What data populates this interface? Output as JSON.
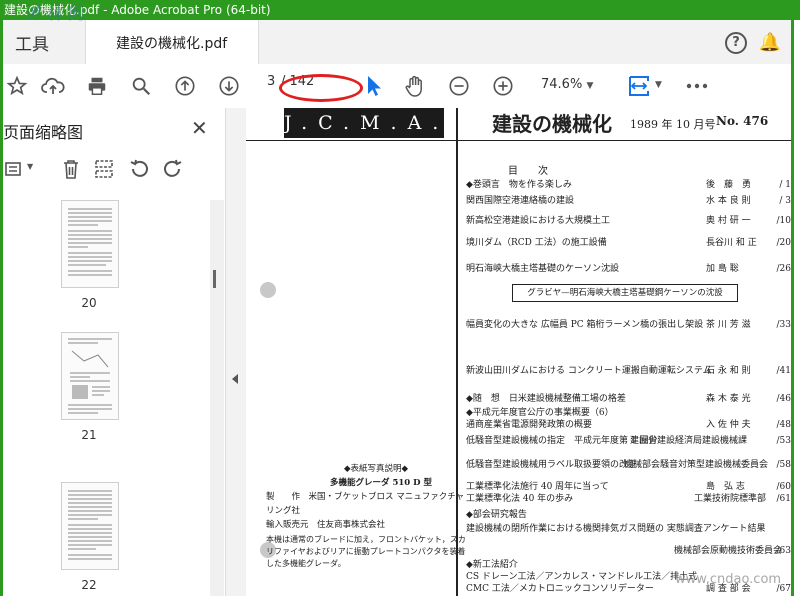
{
  "window": {
    "title": "建設の機械化.pdf - Adobe Acrobat Pro (64-bit)"
  },
  "tabs": {
    "tools_label": "工具",
    "document_label": "建設の機械化.pdf"
  },
  "toolbar": {
    "current_page": "3",
    "total_pages": "/ 142",
    "zoom": "74.6%",
    "icons": [
      "star-icon",
      "cloud-upload-icon",
      "print-icon",
      "search-icon",
      "page-up-icon",
      "page-down-icon",
      "pointer-icon",
      "hand-icon",
      "zoom-out-icon",
      "zoom-in-icon",
      "fit-page-icon",
      "more-icon"
    ]
  },
  "sidebar": {
    "title": "页面缩略图",
    "thumbnails": [
      {
        "label": "20"
      },
      {
        "label": "21"
      },
      {
        "label": "22"
      }
    ]
  },
  "document": {
    "header_badge": "J.C.M.A.",
    "magazine_title": "建設の機械化",
    "issue_date": "1989 年 10 月号",
    "issue_no": "No. 476",
    "toc_title": "目　　次",
    "toc": [
      {
        "title": "◆巻頭言　物を作る楽しみ",
        "author": "後　藤　勇",
        "page": "/ 1"
      },
      {
        "title": "関西国際空港連絡橋の建設",
        "author": "水 本 良 則",
        "page": "/ 3"
      },
      {
        "title": "新高松空港建設における大規模土工",
        "author": "奥 村 研 一",
        "page": "/10"
      },
      {
        "title": "境川ダム（RCD 工法）の施工設備",
        "author": "長谷川 和 正",
        "page": "/20"
      },
      {
        "title": "明石海峡大橋主塔基礎のケーソン沈設",
        "author": "加 島 聡",
        "page": "/26"
      },
      {
        "title": "幅員変化の大きな 広幅員 PC 箱桁ラーメン橋の張出し架設",
        "author": "茶 川 芳 滋",
        "page": "/33"
      },
      {
        "title": "新波山田川ダムにおける コンクリート運搬自動運転システム",
        "author": "石 永 和 則",
        "page": "/41"
      },
      {
        "title": "◆随　想　日米建設機械整備工場の格差",
        "author": "森 木 泰 光",
        "page": "/46"
      },
      {
        "title": "◆平成元年度官公庁の事業概要（6）",
        "author": "",
        "page": ""
      },
      {
        "title": "通商産業省電源開発政策の概要",
        "author": "入 佐 仲 夫",
        "page": "/48"
      },
      {
        "title": "低騒音型建設機械の指定　平成元年度第 1 回分",
        "author": "建設省建設経済局建設機械課",
        "page": "/53"
      },
      {
        "title": "低騒音型建設機械用ラベル取扱要領の改正",
        "author": "機械部会騒音対策型建設機械委員会",
        "page": "/58"
      },
      {
        "title": "工業標準化法施行 40 周年に当って",
        "author": "島　弘 志",
        "page": "/60"
      },
      {
        "title": "工業標準化法 40 年の歩み",
        "author": "工業技術院標準部",
        "page": "/61"
      },
      {
        "title": "◆部会研究報告",
        "author": "",
        "page": ""
      },
      {
        "title": "建設機械の閉所作業における機関排気ガス問題の 実態調査アンケート結果",
        "author": "機械部会原動機技術委員会",
        "page": "/63"
      },
      {
        "title": "◆新工法紹介",
        "author": "",
        "page": ""
      },
      {
        "title": "CS ドレーン工法／アンカレス・マンドレル工法／排土式",
        "author": "",
        "page": ""
      },
      {
        "title": "CMC 工法／メカトロニックコンソリデーター",
        "author": "調 査 部 会",
        "page": "/67"
      }
    ],
    "gravure": "グラビヤ—明石海峡大橋主塔基礎鋼ケーソンの沈設",
    "cover": {
      "heading": "◆表紙写真説明◆",
      "model": "多機能グレーダ 510 D 型",
      "maker_label": "製　　作",
      "maker": "米国・ブケットブロス マニュファクチャリング社",
      "importer_label": "輸入販売元",
      "importer": "住友商事株式会社",
      "body": "本機は通常のブレードに加え，フロントバケット，スカリファイヤおよびリアに振動プレートコンパクタを装着した多機能グレーダ。"
    }
  },
  "watermarks": {
    "top": "道 林 网",
    "bottom": "www.cndao.com"
  }
}
